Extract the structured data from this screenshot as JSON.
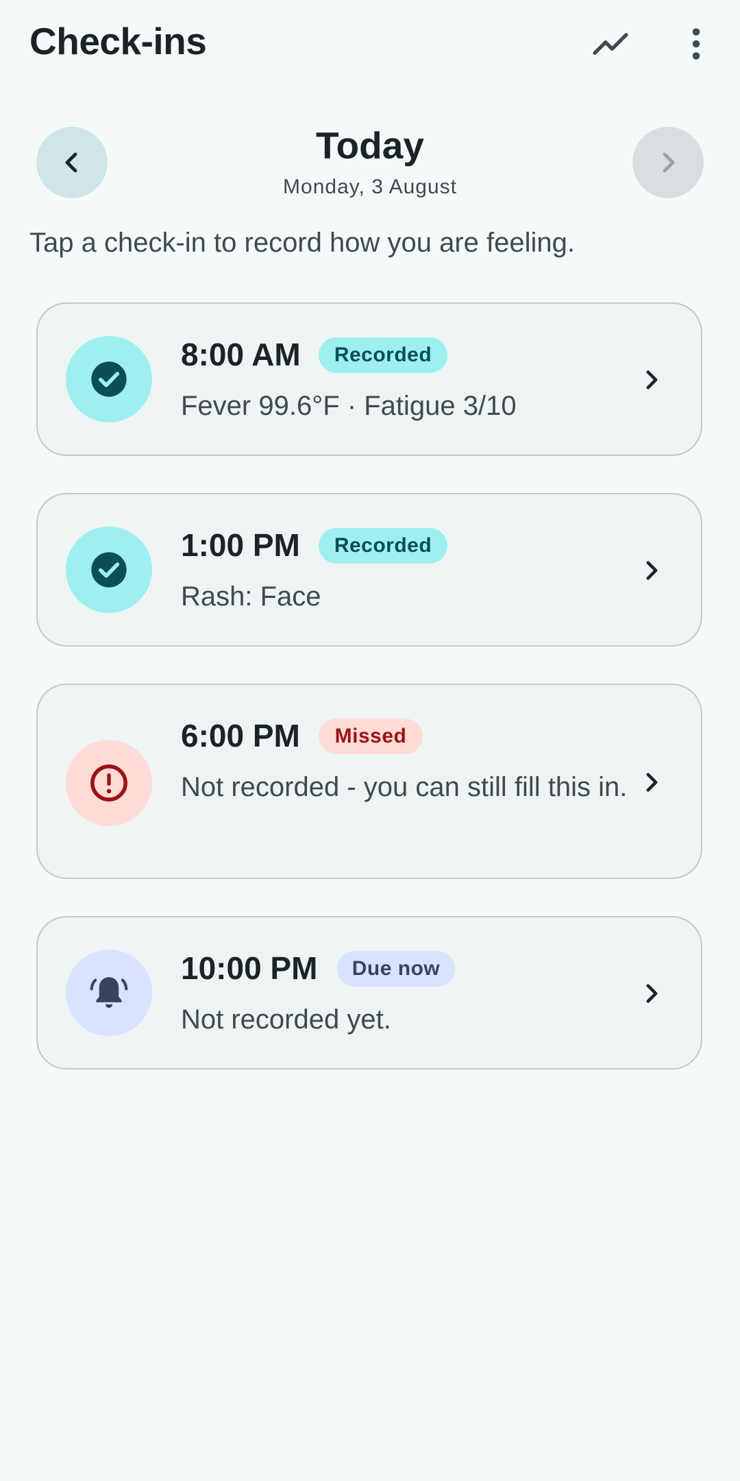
{
  "app_bar": {
    "title": "Check-ins",
    "trend_icon": "trending-up-icon",
    "more_icon": "more-vert-icon"
  },
  "date_nav": {
    "title": "Today",
    "subtitle": "Monday, 3 August",
    "prev_icon": "chevron-left-icon",
    "next_icon": "chevron-right-icon",
    "next_enabled": false
  },
  "instructions": "Tap a check-in to record how you are feeling.",
  "checkins": [
    {
      "time": "8:00 AM",
      "status": "Recorded",
      "summary": "Fever 99.6°F · Fatigue 3/10",
      "icon": "check-circle-icon"
    },
    {
      "time": "1:00 PM",
      "status": "Recorded",
      "summary": "Rash: Face",
      "icon": "check-circle-icon"
    },
    {
      "time": "6:00 PM",
      "status": "Missed",
      "summary": "Not recorded - you can still fill this in.",
      "icon": "error-icon"
    },
    {
      "time": "10:00 PM",
      "status": "Due now",
      "summary": "Not recorded yet.",
      "icon": "bell-ringing-icon"
    }
  ],
  "colors": {
    "background": "#f4fafa",
    "card": "#eef4f4",
    "recorded_bg": "#9ef0f0",
    "recorded_fg": "#0b4e55",
    "missed_bg": "#ffdad7",
    "missed_fg": "#9b1216",
    "due_bg": "#d9e2ff",
    "due_fg": "#36455d"
  }
}
